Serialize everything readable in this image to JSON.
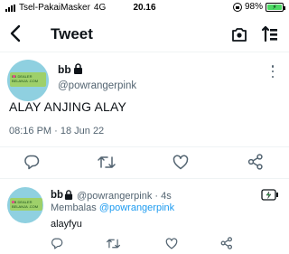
{
  "status_bar": {
    "carrier": "Tsel-PakaiMasker",
    "network": "4G",
    "time": "20.16",
    "battery": "98%"
  },
  "nav": {
    "title": "Tweet"
  },
  "tweet": {
    "avatar_text": "BB DEALER BELANJA .COM",
    "name": "bb",
    "handle": "@powrangerpink",
    "text": "ALAY ANJING ALAY",
    "timestamp": "08:16 PM · 18 Jun 22"
  },
  "reply": {
    "avatar_text": "BB DEALER BELANJA .COM",
    "name": "bb",
    "handle": "@powrangerpink",
    "time": "· 4s",
    "replying_to_label": "Membalas",
    "replying_to_handle": "@powrangerpink",
    "text": "alayfyu"
  },
  "colors": {
    "accent": "#1d9bf0",
    "secondary_text": "#536471",
    "battery_charging": "#4cd964"
  },
  "icons": [
    "back-arrow-icon",
    "camera-icon",
    "sort-icon",
    "lock-icon",
    "more-icon",
    "reply-icon",
    "retweet-icon",
    "like-icon",
    "share-icon"
  ]
}
